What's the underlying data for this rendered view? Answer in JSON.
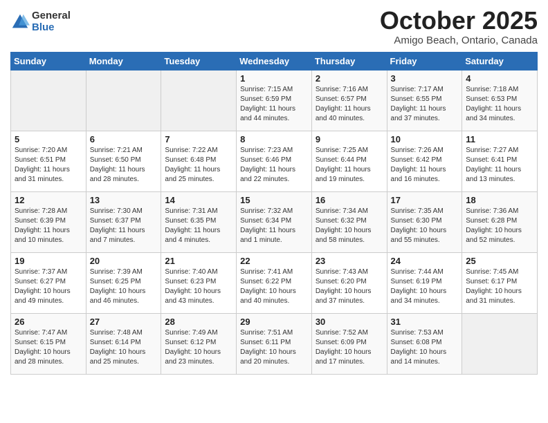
{
  "header": {
    "logo_general": "General",
    "logo_blue": "Blue",
    "month_title": "October 2025",
    "location": "Amigo Beach, Ontario, Canada"
  },
  "days_of_week": [
    "Sunday",
    "Monday",
    "Tuesday",
    "Wednesday",
    "Thursday",
    "Friday",
    "Saturday"
  ],
  "weeks": [
    [
      {
        "num": "",
        "info": ""
      },
      {
        "num": "",
        "info": ""
      },
      {
        "num": "",
        "info": ""
      },
      {
        "num": "1",
        "info": "Sunrise: 7:15 AM\nSunset: 6:59 PM\nDaylight: 11 hours\nand 44 minutes."
      },
      {
        "num": "2",
        "info": "Sunrise: 7:16 AM\nSunset: 6:57 PM\nDaylight: 11 hours\nand 40 minutes."
      },
      {
        "num": "3",
        "info": "Sunrise: 7:17 AM\nSunset: 6:55 PM\nDaylight: 11 hours\nand 37 minutes."
      },
      {
        "num": "4",
        "info": "Sunrise: 7:18 AM\nSunset: 6:53 PM\nDaylight: 11 hours\nand 34 minutes."
      }
    ],
    [
      {
        "num": "5",
        "info": "Sunrise: 7:20 AM\nSunset: 6:51 PM\nDaylight: 11 hours\nand 31 minutes."
      },
      {
        "num": "6",
        "info": "Sunrise: 7:21 AM\nSunset: 6:50 PM\nDaylight: 11 hours\nand 28 minutes."
      },
      {
        "num": "7",
        "info": "Sunrise: 7:22 AM\nSunset: 6:48 PM\nDaylight: 11 hours\nand 25 minutes."
      },
      {
        "num": "8",
        "info": "Sunrise: 7:23 AM\nSunset: 6:46 PM\nDaylight: 11 hours\nand 22 minutes."
      },
      {
        "num": "9",
        "info": "Sunrise: 7:25 AM\nSunset: 6:44 PM\nDaylight: 11 hours\nand 19 minutes."
      },
      {
        "num": "10",
        "info": "Sunrise: 7:26 AM\nSunset: 6:42 PM\nDaylight: 11 hours\nand 16 minutes."
      },
      {
        "num": "11",
        "info": "Sunrise: 7:27 AM\nSunset: 6:41 PM\nDaylight: 11 hours\nand 13 minutes."
      }
    ],
    [
      {
        "num": "12",
        "info": "Sunrise: 7:28 AM\nSunset: 6:39 PM\nDaylight: 11 hours\nand 10 minutes."
      },
      {
        "num": "13",
        "info": "Sunrise: 7:30 AM\nSunset: 6:37 PM\nDaylight: 11 hours\nand 7 minutes."
      },
      {
        "num": "14",
        "info": "Sunrise: 7:31 AM\nSunset: 6:35 PM\nDaylight: 11 hours\nand 4 minutes."
      },
      {
        "num": "15",
        "info": "Sunrise: 7:32 AM\nSunset: 6:34 PM\nDaylight: 11 hours\nand 1 minute."
      },
      {
        "num": "16",
        "info": "Sunrise: 7:34 AM\nSunset: 6:32 PM\nDaylight: 10 hours\nand 58 minutes."
      },
      {
        "num": "17",
        "info": "Sunrise: 7:35 AM\nSunset: 6:30 PM\nDaylight: 10 hours\nand 55 minutes."
      },
      {
        "num": "18",
        "info": "Sunrise: 7:36 AM\nSunset: 6:28 PM\nDaylight: 10 hours\nand 52 minutes."
      }
    ],
    [
      {
        "num": "19",
        "info": "Sunrise: 7:37 AM\nSunset: 6:27 PM\nDaylight: 10 hours\nand 49 minutes."
      },
      {
        "num": "20",
        "info": "Sunrise: 7:39 AM\nSunset: 6:25 PM\nDaylight: 10 hours\nand 46 minutes."
      },
      {
        "num": "21",
        "info": "Sunrise: 7:40 AM\nSunset: 6:23 PM\nDaylight: 10 hours\nand 43 minutes."
      },
      {
        "num": "22",
        "info": "Sunrise: 7:41 AM\nSunset: 6:22 PM\nDaylight: 10 hours\nand 40 minutes."
      },
      {
        "num": "23",
        "info": "Sunrise: 7:43 AM\nSunset: 6:20 PM\nDaylight: 10 hours\nand 37 minutes."
      },
      {
        "num": "24",
        "info": "Sunrise: 7:44 AM\nSunset: 6:19 PM\nDaylight: 10 hours\nand 34 minutes."
      },
      {
        "num": "25",
        "info": "Sunrise: 7:45 AM\nSunset: 6:17 PM\nDaylight: 10 hours\nand 31 minutes."
      }
    ],
    [
      {
        "num": "26",
        "info": "Sunrise: 7:47 AM\nSunset: 6:15 PM\nDaylight: 10 hours\nand 28 minutes."
      },
      {
        "num": "27",
        "info": "Sunrise: 7:48 AM\nSunset: 6:14 PM\nDaylight: 10 hours\nand 25 minutes."
      },
      {
        "num": "28",
        "info": "Sunrise: 7:49 AM\nSunset: 6:12 PM\nDaylight: 10 hours\nand 23 minutes."
      },
      {
        "num": "29",
        "info": "Sunrise: 7:51 AM\nSunset: 6:11 PM\nDaylight: 10 hours\nand 20 minutes."
      },
      {
        "num": "30",
        "info": "Sunrise: 7:52 AM\nSunset: 6:09 PM\nDaylight: 10 hours\nand 17 minutes."
      },
      {
        "num": "31",
        "info": "Sunrise: 7:53 AM\nSunset: 6:08 PM\nDaylight: 10 hours\nand 14 minutes."
      },
      {
        "num": "",
        "info": ""
      }
    ]
  ]
}
